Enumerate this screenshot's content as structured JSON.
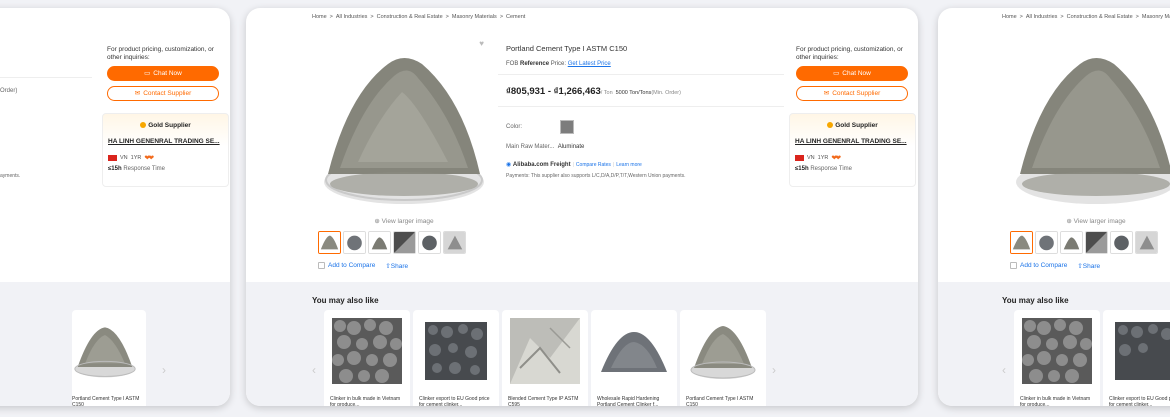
{
  "breadcrumb": {
    "items": [
      "Home",
      "All Industries",
      "Construction & Real Estate",
      "Masonry Materials",
      "Cement"
    ],
    "separator": ">"
  },
  "product": {
    "title": "Portland Cement Type I ASTM C150",
    "fob_label": "FOB",
    "reference_label": "Reference",
    "price_word": "Price:",
    "latest_price_link": "Get Latest Price",
    "price_range": "₫805,931 - ₫1,266,463",
    "price_unit": "/ Ton",
    "moq_value": "5000 Ton/Tons",
    "moq_label": "(Min. Order)",
    "color_label": "Color:",
    "swatch_color": "#7d7d7d",
    "raw_label": "Main Raw Mater...",
    "raw_value": "Aluminate",
    "freight_label": "Alibaba.com Freight",
    "compare_rates": "Compare Rates",
    "learn_more": "Learn more",
    "payments": "Payments:  This supplier also supports L/C,D/A,D/P,T/T,Western Union payments."
  },
  "gallery": {
    "view_larger": "View larger image",
    "add_compare": "Add to Compare",
    "share": "Share"
  },
  "inquiry": {
    "text": "For product pricing, customization, or other inquiries:",
    "chat_now": "Chat Now",
    "contact_supplier": "Contact Supplier"
  },
  "supplier": {
    "badge": "Gold Supplier",
    "name": "HA LINH GENENRAL TRADING SE...",
    "country": "VN",
    "years": "1YR",
    "response_value": "≤15h",
    "response_label": "Response Time"
  },
  "left_partial": {
    "order_text": "Order)",
    "payments_text": "ayments."
  },
  "recommend": {
    "title": "You may also like",
    "items": [
      {
        "name": "Clinker in bulk made in Vietnam for produce..."
      },
      {
        "name": "Clinker export to EU Good price for cement clinker..."
      },
      {
        "name": "Blended Cement Type IP ASTM C595"
      },
      {
        "name": "Wholesale Rapid Hardening Portland Cement Clinker f..."
      },
      {
        "name": "Portland Cement Type I ASTM C150"
      }
    ]
  },
  "colors": {
    "accent": "#ff6a00",
    "link": "#1a73e8",
    "gold": "#f7a700"
  }
}
